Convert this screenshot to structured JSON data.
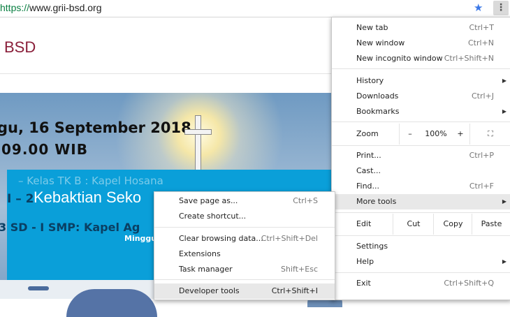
{
  "browser": {
    "url_scheme": "https://",
    "url_host": "www.grii-bsd.org"
  },
  "page": {
    "logo_text": "BSD",
    "hero_line1": "gu, 16 September 2018",
    "hero_line2": "09.00  WIB",
    "bg_line1": "– Kelas TK B : Kapel Hosana",
    "bg_line2": "I – 2",
    "bg_line3": "3 SD - I SMP: Kapel Ag",
    "banner_title": "Kebaktian Seko",
    "banner_sub": "Minggu"
  },
  "main_menu": {
    "items": {
      "new_tab": {
        "label": "New tab",
        "shortcut": "Ctrl+T"
      },
      "new_window": {
        "label": "New window",
        "shortcut": "Ctrl+N"
      },
      "new_incognito": {
        "label": "New incognito window",
        "shortcut": "Ctrl+Shift+N"
      },
      "history": {
        "label": "History"
      },
      "downloads": {
        "label": "Downloads",
        "shortcut": "Ctrl+J"
      },
      "bookmarks": {
        "label": "Bookmarks"
      },
      "zoom": {
        "label": "Zoom",
        "minus": "–",
        "value": "100%",
        "plus": "+"
      },
      "print": {
        "label": "Print...",
        "shortcut": "Ctrl+P"
      },
      "cast": {
        "label": "Cast..."
      },
      "find": {
        "label": "Find...",
        "shortcut": "Ctrl+F"
      },
      "more_tools": {
        "label": "More tools"
      },
      "edit": {
        "label": "Edit",
        "cut": "Cut",
        "copy": "Copy",
        "paste": "Paste"
      },
      "settings": {
        "label": "Settings"
      },
      "help": {
        "label": "Help"
      },
      "exit": {
        "label": "Exit",
        "shortcut": "Ctrl+Shift+Q"
      }
    }
  },
  "sub_menu": {
    "items": {
      "save_page": {
        "label": "Save page as...",
        "shortcut": "Ctrl+S"
      },
      "create_shortcut": {
        "label": "Create shortcut..."
      },
      "clear_data": {
        "label": "Clear browsing data...",
        "shortcut": "Ctrl+Shift+Del"
      },
      "extensions": {
        "label": "Extensions"
      },
      "task_manager": {
        "label": "Task manager",
        "shortcut": "Shift+Esc"
      },
      "dev_tools": {
        "label": "Developer tools",
        "shortcut": "Ctrl+Shift+I"
      }
    }
  },
  "icons": {
    "bookmark": "star-icon",
    "menu": "kebab-menu-icon",
    "fullscreen": "fullscreen-icon",
    "submenu": "chevron-right-icon"
  },
  "colors": {
    "accent": "#3b78e7",
    "banner": "#0a9fd9",
    "logo": "#8a1f3a",
    "hover": "#e8e8e8"
  }
}
